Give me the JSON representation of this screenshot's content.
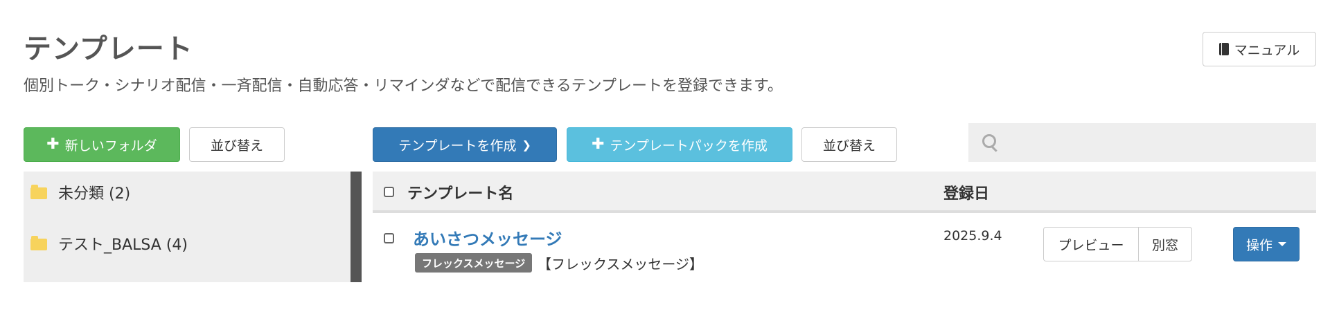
{
  "header": {
    "title": "テンプレート",
    "description": "個別トーク・シナリオ配信・一斉配信・自動応答・リマインダなどで配信できるテンプレートを登録できます。",
    "manual_label": "マニュアル"
  },
  "toolbar": {
    "new_folder_label": "新しいフォルダ",
    "sort_folders_label": "並び替え",
    "create_template_label": "テンプレートを作成",
    "create_pack_label": "テンプレートパックを作成",
    "sort_templates_label": "並び替え",
    "search": {
      "value": "",
      "placeholder": ""
    }
  },
  "sidebar": {
    "folders": [
      {
        "label": "未分類 (2)"
      },
      {
        "label": "テスト_BALSA (4)"
      }
    ]
  },
  "table": {
    "columns": {
      "name": "テンプレート名",
      "date": "登録日"
    },
    "rows": [
      {
        "title": "あいさつメッセージ",
        "tag": "フレックスメッセージ",
        "subtitle": "【フレックスメッセージ】",
        "date": "2025.9.4",
        "preview_label": "プレビュー",
        "new_window_label": "別窓",
        "actions_label": "操作"
      }
    ]
  },
  "colors": {
    "primary": "#337ab7",
    "success": "#5cb85c",
    "info": "#5bc0de",
    "folder": "#f7d35c",
    "tag_bg": "#777777"
  },
  "icons": {
    "manual": "book-icon",
    "add": "plus-icon",
    "dropdown": "chevron-down-icon",
    "search": "search-icon",
    "folder": "folder-icon",
    "caret": "caret-down-icon"
  }
}
